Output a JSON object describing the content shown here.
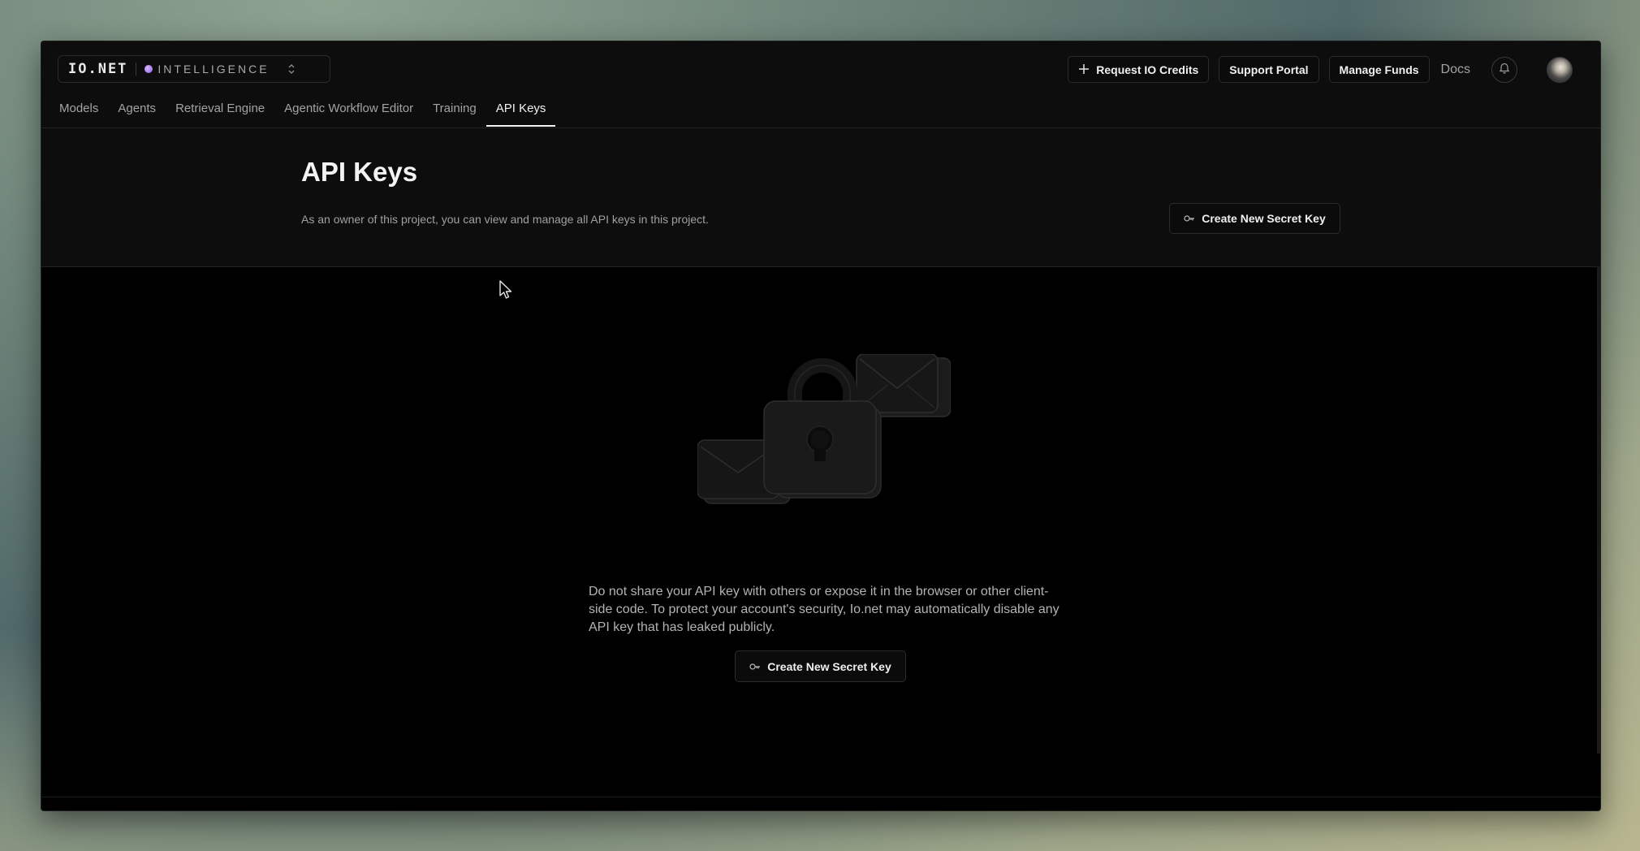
{
  "brand": {
    "logo": "IO.NET",
    "product": "INTELLIGENCE"
  },
  "nav": {
    "tabs": [
      {
        "label": "Models"
      },
      {
        "label": "Agents"
      },
      {
        "label": "Retrieval Engine"
      },
      {
        "label": "Agentic Workflow Editor"
      },
      {
        "label": "Training"
      },
      {
        "label": "API Keys",
        "active": true
      }
    ]
  },
  "top_actions": {
    "request_credits": "Request IO Credits",
    "support_portal": "Support Portal",
    "manage_funds": "Manage Funds",
    "docs": "Docs"
  },
  "page": {
    "title": "API Keys",
    "description": "As an owner of this project, you can view and manage all API keys in this project.",
    "create_button": "Create New Secret Key"
  },
  "empty_state": {
    "message": "Do not share your API key with others or expose it in the browser or other client-side code. To protect your account's security, Io.net may automatically disable any API key that has leaked publicly.",
    "create_button": "Create New Secret Key"
  },
  "colors": {
    "background": "#000000",
    "panel": "#0d0d0d",
    "border": "#2b2b2b",
    "text_primary": "#f2f2f2",
    "text_secondary": "#a3a3a3",
    "accent_dot": "#a77cf0"
  },
  "icons": {
    "plus": "plus-icon",
    "bell": "bell-icon",
    "key": "key-icon",
    "selector": "chevron-up-down-icon",
    "illustration": "lock-envelopes-illustration"
  }
}
